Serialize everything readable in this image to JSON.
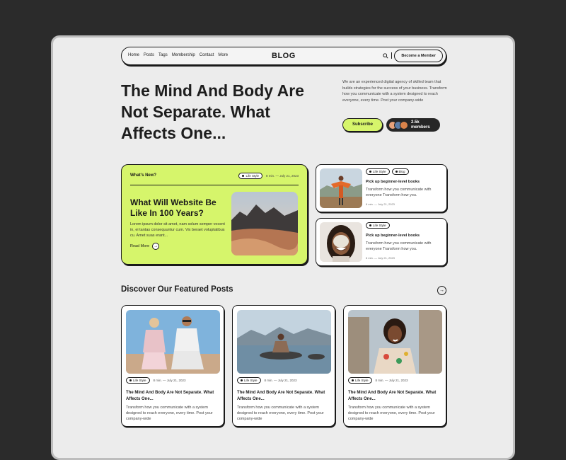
{
  "nav": {
    "links": [
      "Home",
      "Posts",
      "Tags",
      "Membership",
      "Contact",
      "More"
    ],
    "logo": "BLOG",
    "cta": "Become a Member"
  },
  "hero": {
    "title": "The Mind And Body Are Not Separate. What Affects One...",
    "description": "We are an experienced digital agency of skilled team that builds strategies for the success of your business. Transform how you communicate with a system designed to reach everyone, every time. Post your company-wide",
    "subscribe": "Subscribe",
    "members_count": "2.5k",
    "members_label": "members"
  },
  "featured": {
    "label": "What's New?",
    "tag": "Life Style",
    "meta": "8 min. — July 21, 2023",
    "title": "What Will Website Be Like In 100 Years?",
    "text": "Lorem ipsum dolor sit amet, nam solum semper vocent in, ei tantas consequuntur cum. Vix beraet voluptatibus cu. Amet suas erant...",
    "read_more": "Read More"
  },
  "side_posts": [
    {
      "tags": [
        "Life Style",
        "Blog"
      ],
      "title": "Pick up beginner-level books",
      "text": "Transform how you communicate with everyone Transform how you.",
      "meta": "8 min. — July 21, 2023"
    },
    {
      "tags": [
        "Life Style"
      ],
      "title": "Pick up beginner-level books",
      "text": "Transform how you communicate with everyone Transform how you.",
      "meta": "8 min. — July 21, 2023"
    }
  ],
  "section": {
    "title": "Discover Our Featured Posts"
  },
  "posts": [
    {
      "tag": "Life Style",
      "meta": "8 min. — July 21, 2023",
      "title": "The Mind And Body Are Not Separate. What Affects One...",
      "text": "Transform how you communicate with a system designed to reach everyone, every time. Post your company-wide"
    },
    {
      "tag": "Life Style",
      "meta": "8 min. — July 21, 2023",
      "title": "The Mind And Body Are Not Separate. What Affects One...",
      "text": "Transform how you communicate with a system designed to reach everyone, every time. Post your company-wide"
    },
    {
      "tag": "Life Style",
      "meta": "8 min. — July 21, 2023",
      "title": "The Mind And Body Are Not Separate. What Affects One...",
      "text": "Transform how you communicate with a system designed to reach everyone, every time. Post your company-wide"
    }
  ],
  "colors": {
    "accent": "#d6f56b",
    "dark": "#1a1a1a",
    "page_bg": "#2b2b2b",
    "surface": "#ececec"
  }
}
